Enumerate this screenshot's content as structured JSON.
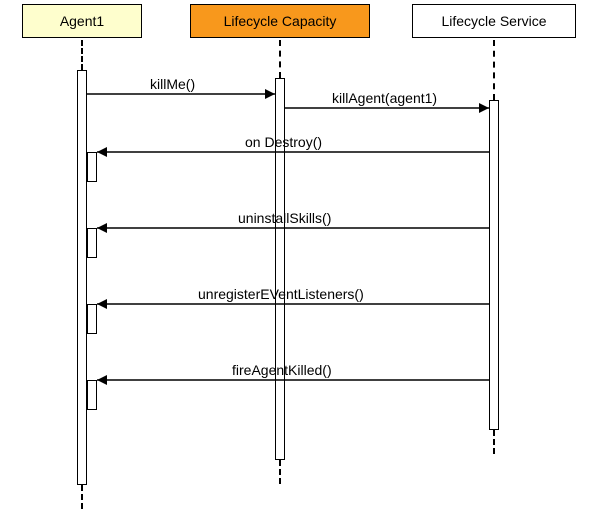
{
  "participants": {
    "agent1": "Agent1",
    "capacity": "Lifecycle Capacity",
    "service": "Lifecycle Service"
  },
  "messages": {
    "m1": "killMe()",
    "m2": "killAgent(agent1)",
    "m3": "on Destroy()",
    "m4": "uninstallSkills()",
    "m5": "unregisterEVentListeners()",
    "m6": "fireAgentKilled()"
  },
  "chart_data": {
    "type": "sequence-diagram",
    "participants": [
      {
        "id": "agent1",
        "label": "Agent1",
        "highlight": false
      },
      {
        "id": "capacity",
        "label": "Lifecycle Capacity",
        "highlight": true
      },
      {
        "id": "service",
        "label": "Lifecycle Service",
        "highlight": false
      }
    ],
    "messages": [
      {
        "from": "agent1",
        "to": "capacity",
        "label": "killMe()"
      },
      {
        "from": "capacity",
        "to": "service",
        "label": "killAgent(agent1)"
      },
      {
        "from": "service",
        "to": "agent1",
        "label": "on Destroy()"
      },
      {
        "from": "service",
        "to": "agent1",
        "label": "uninstallSkills()"
      },
      {
        "from": "service",
        "to": "agent1",
        "label": "unregisterEVentListeners()"
      },
      {
        "from": "service",
        "to": "agent1",
        "label": "fireAgentKilled()"
      }
    ]
  }
}
